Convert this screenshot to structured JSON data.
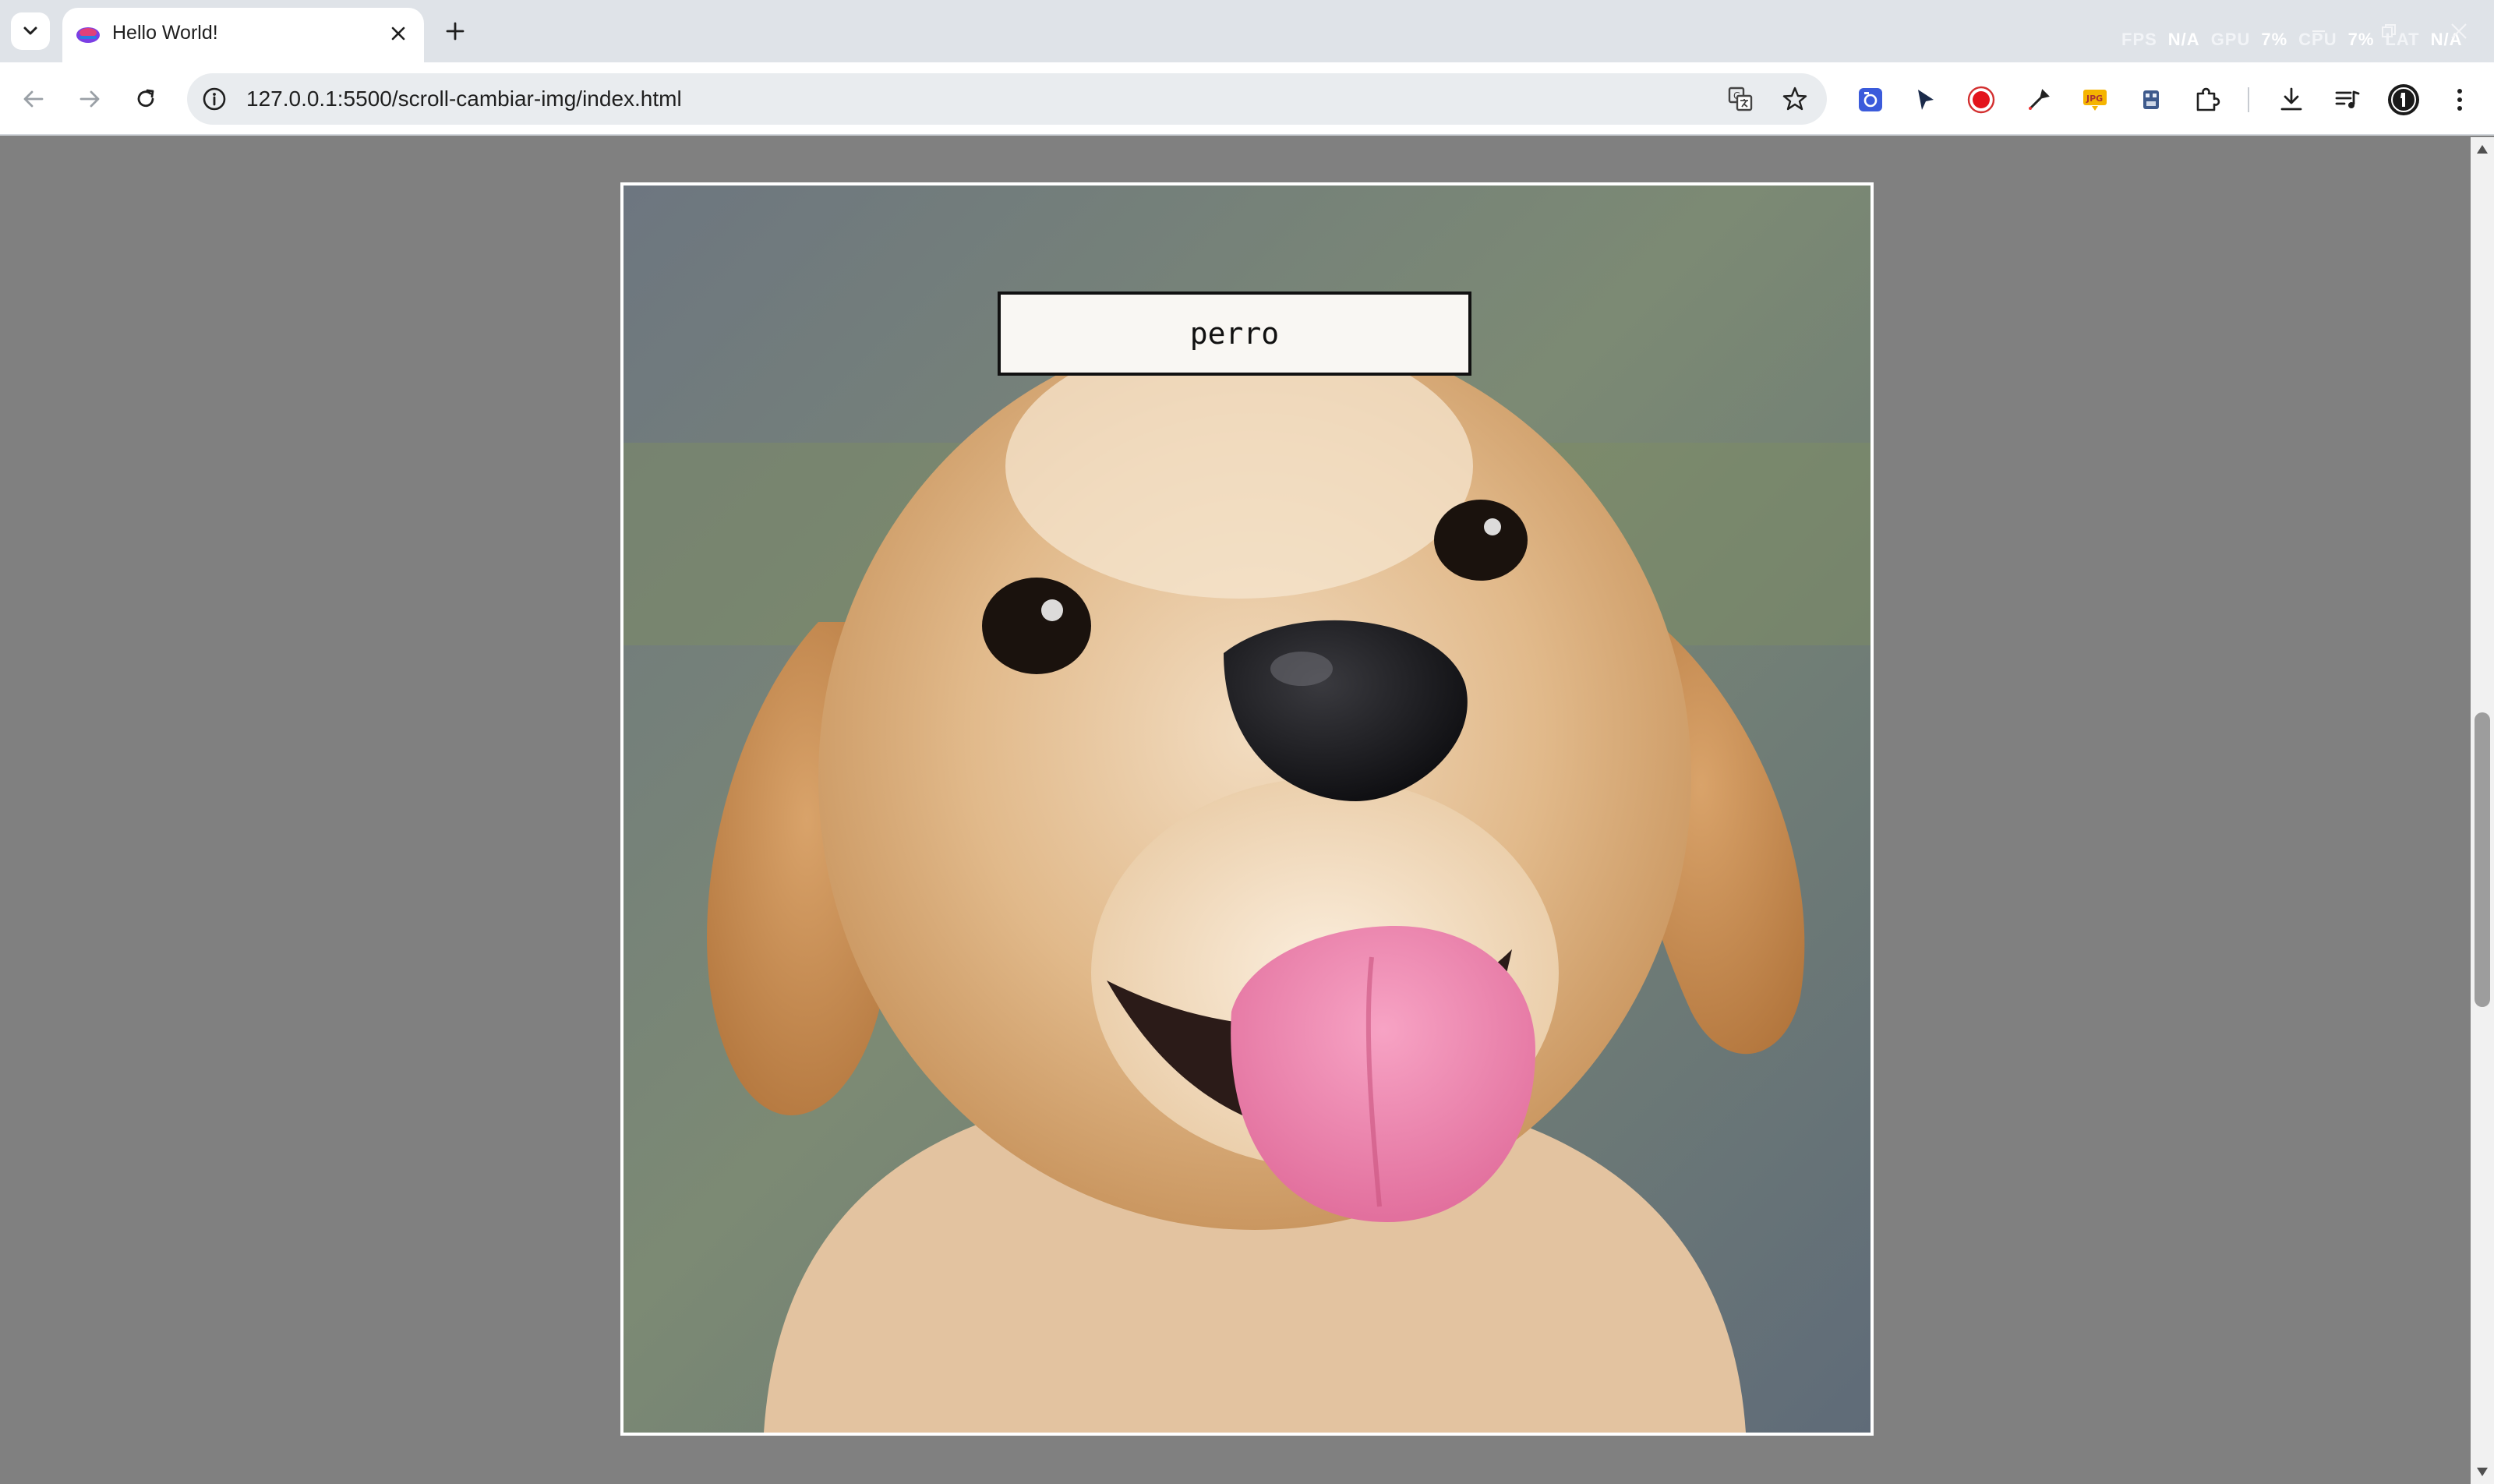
{
  "browser": {
    "tab": {
      "title": "Hello World!"
    },
    "address_bar": {
      "url": "127.0.0.1:5500/scroll-cambiar-img/index.html"
    },
    "perf_overlay": {
      "fps_label": "FPS",
      "fps_value": "N/A",
      "gpu_label": "GPU",
      "gpu_value": "7%",
      "cpu_label": "CPU",
      "cpu_value": "7%",
      "lat_label": "LAT",
      "lat_value": "N/A"
    },
    "extensions": [
      "screenshot-icon",
      "cursor-icon",
      "record-icon",
      "eyedropper-icon",
      "jpg-icon",
      "robot-icon",
      "puzzle-icon"
    ],
    "accent_color": "#0b57d0"
  },
  "page": {
    "image": {
      "subject": "puppy-photo"
    },
    "caption": "perro"
  }
}
